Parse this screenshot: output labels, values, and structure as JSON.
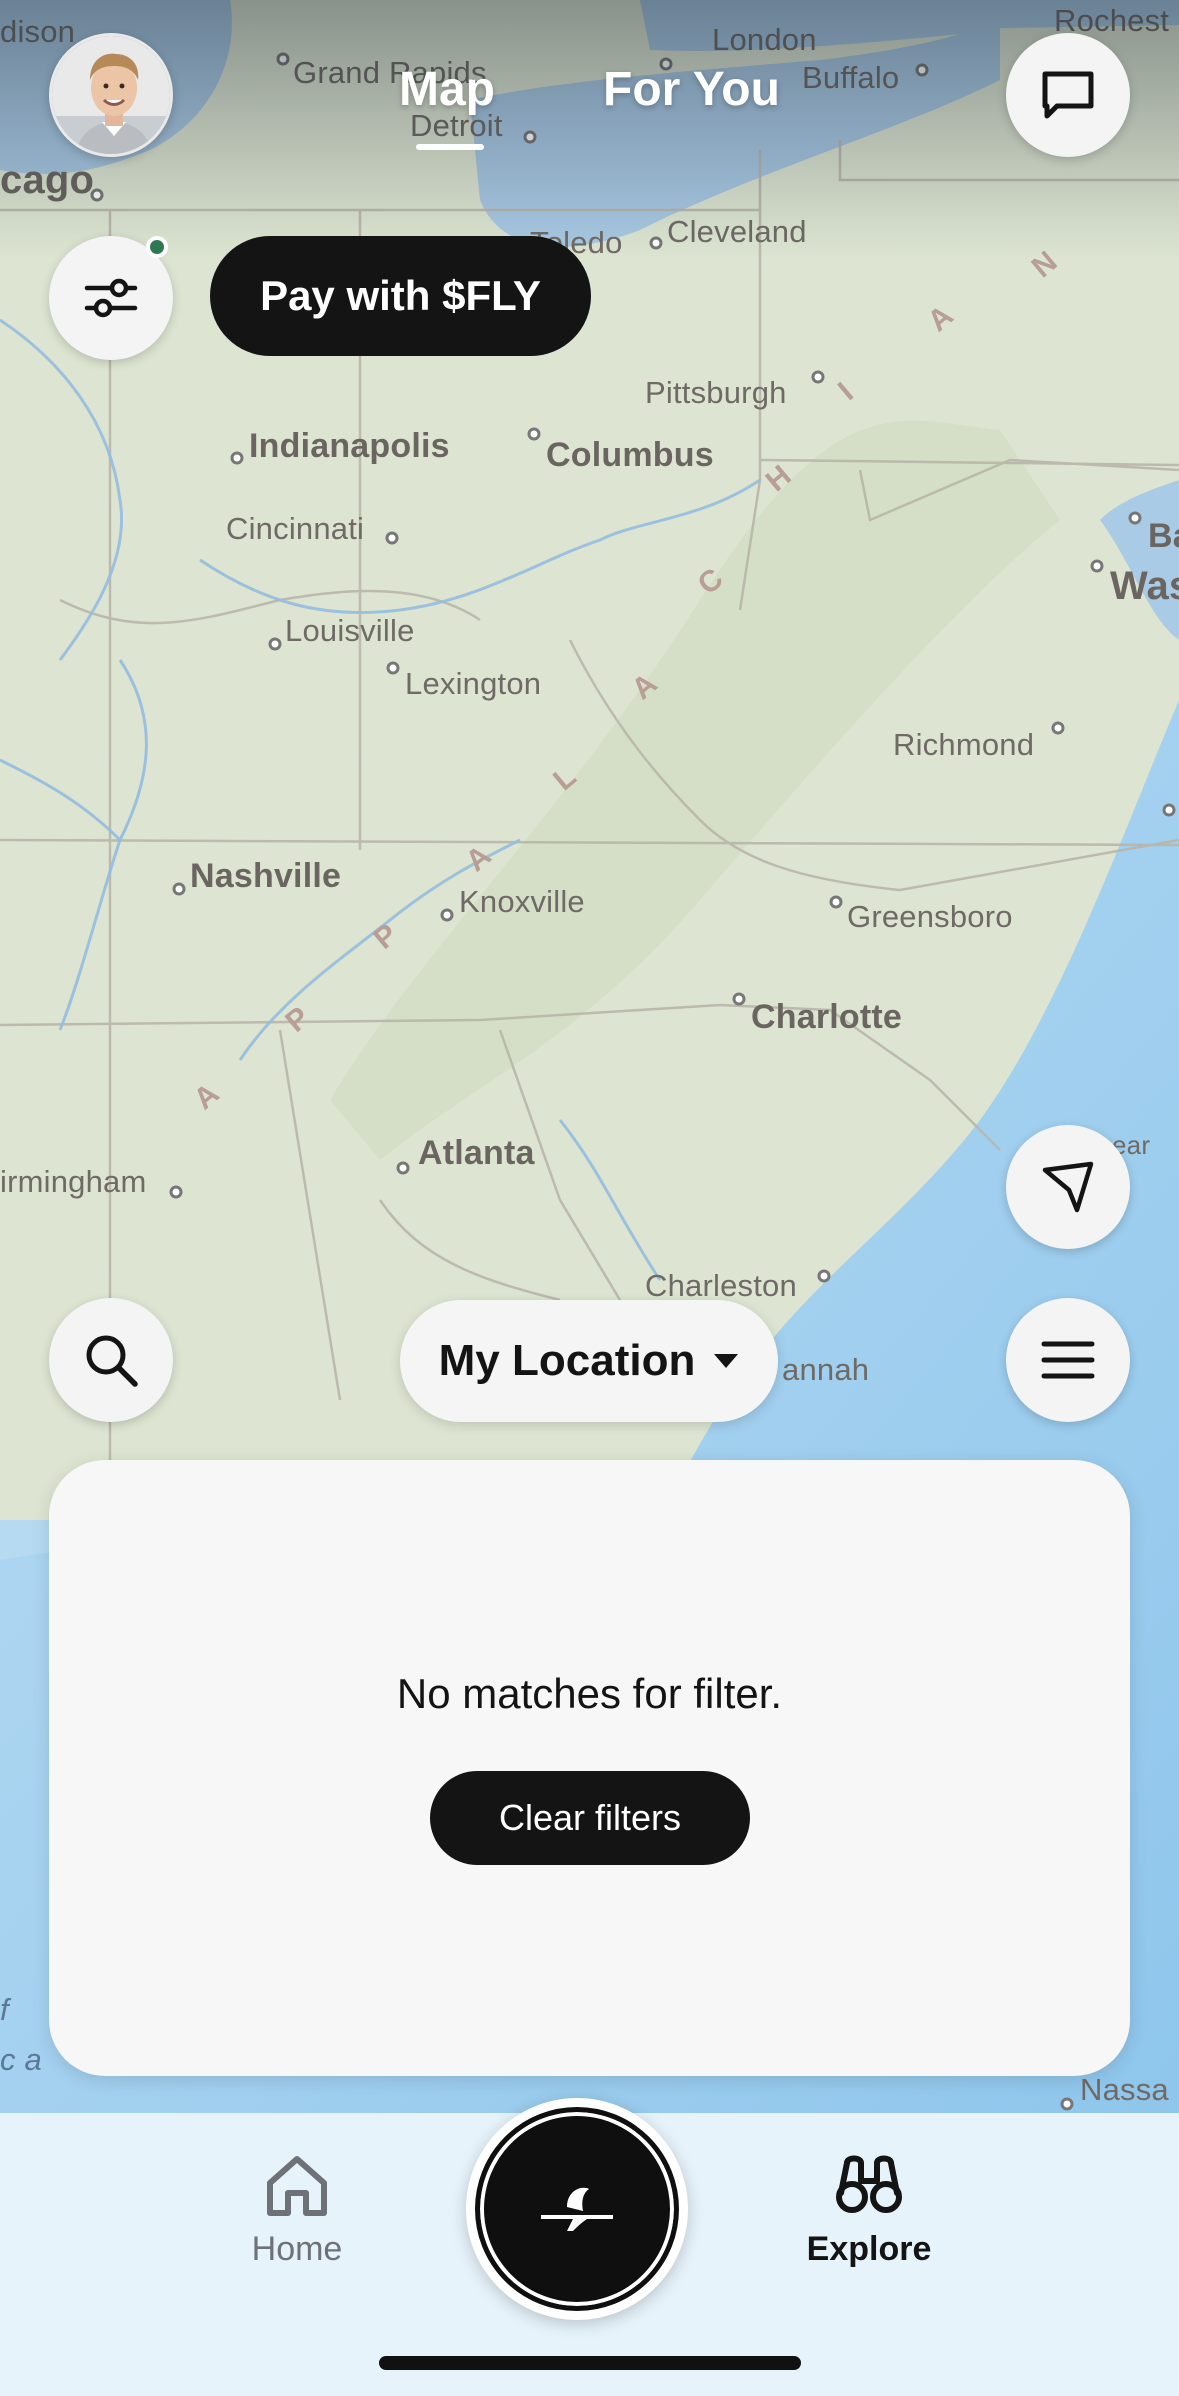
{
  "header": {
    "tabs": [
      {
        "label": "Map",
        "active": true
      },
      {
        "label": "For You",
        "active": false
      }
    ],
    "pay_button": "Pay with $FLY"
  },
  "map": {
    "cities": [
      {
        "name": "Grand Rapids"
      },
      {
        "name": "London"
      },
      {
        "name": "Buffalo"
      },
      {
        "name": "Rochest"
      },
      {
        "name": "Detroit"
      },
      {
        "name": "dison"
      },
      {
        "name": "cago"
      },
      {
        "name": "Toledo"
      },
      {
        "name": "Cleveland"
      },
      {
        "name": "Pittsburgh"
      },
      {
        "name": "Indianapolis"
      },
      {
        "name": "Columbus"
      },
      {
        "name": "Cincinnati"
      },
      {
        "name": "Ba"
      },
      {
        "name": "Was"
      },
      {
        "name": "Louisville"
      },
      {
        "name": "Lexington"
      },
      {
        "name": "Richmond"
      },
      {
        "name": "Nashville"
      },
      {
        "name": "Knoxville"
      },
      {
        "name": "Greensboro"
      },
      {
        "name": "Charlotte"
      },
      {
        "name": "Atlanta"
      },
      {
        "name": "irmingham"
      },
      {
        "name": "ear"
      },
      {
        "name": "Charleston"
      },
      {
        "name": "annah"
      },
      {
        "name": "Nassa"
      },
      {
        "name": "f"
      },
      {
        "name": "c a"
      }
    ],
    "range_letters": [
      "A",
      "P",
      "P",
      "A",
      "L",
      "A",
      "C",
      "H",
      "I",
      "A",
      "N"
    ]
  },
  "location_selector": {
    "label": "My Location"
  },
  "results": {
    "empty_message": "No matches for filter.",
    "clear_button": "Clear filters"
  },
  "bottom_nav": {
    "home_label": "Home",
    "explore_label": "Explore"
  },
  "colors": {
    "dark": "#141414",
    "notify_dot": "#2d7a52",
    "nav_background": "#e7f3fb",
    "ocean": "#a8d2ef",
    "land": "#dfe6d6"
  }
}
